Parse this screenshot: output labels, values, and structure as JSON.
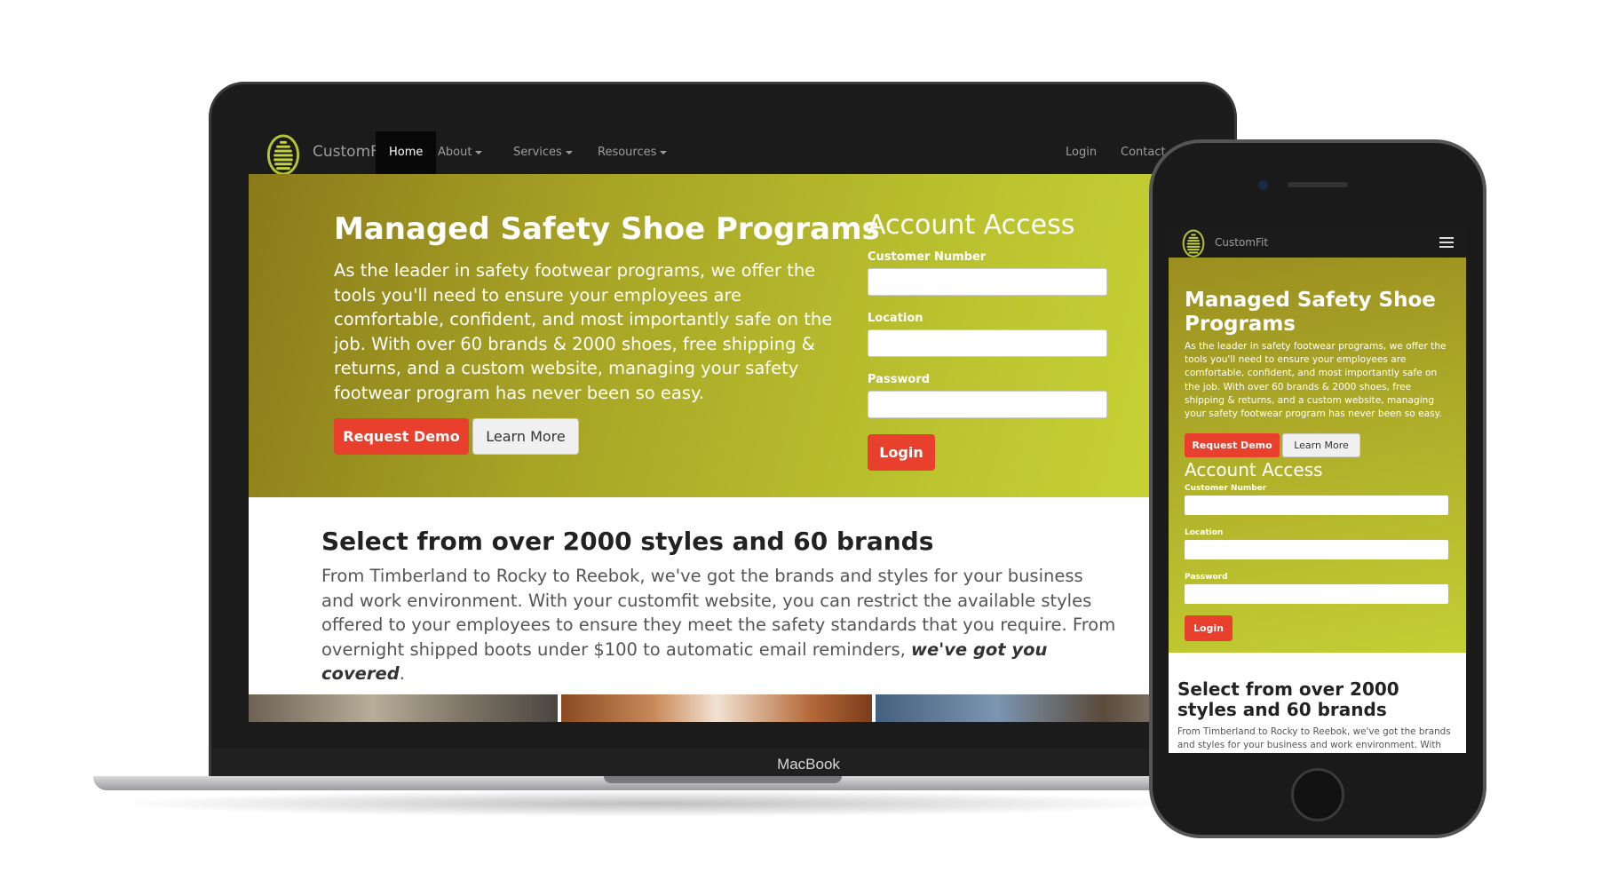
{
  "device_labels": {
    "laptop": "MacBook"
  },
  "site": {
    "brand": "CustomFit",
    "nav": {
      "items": [
        {
          "label": "Home",
          "dropdown": false,
          "active": true
        },
        {
          "label": "About",
          "dropdown": true
        },
        {
          "label": "Services",
          "dropdown": true
        },
        {
          "label": "Resources",
          "dropdown": true
        }
      ],
      "right": [
        {
          "label": "Login"
        },
        {
          "label": "Contact"
        }
      ]
    },
    "hero": {
      "title": "Managed Safety Shoe Programs",
      "body": "As the leader in safety footwear programs, we offer the tools you'll need to ensure your employees are comfortable, confident, and most importantly safe on the job. With over 60 brands & 2000 shoes, free shipping & returns, and a custom website, managing your safety footwear program has never been so easy.",
      "primary_button": "Request Demo",
      "secondary_button": "Learn More"
    },
    "account": {
      "title": "Account Access",
      "fields": [
        "Customer Number",
        "Location",
        "Password"
      ],
      "submit": "Login"
    },
    "section": {
      "title": "Select from over 2000 styles and 60 brands",
      "body": "From Timberland to Rocky to Reebok, we've got the brands and styles for your business and work environment. With your customfit website, you can restrict the available styles offered to your employees to ensure they meet the safety standards that you require. From overnight shipped boots under $100 to automatic email reminders, ",
      "emphasis": "we've got you covered",
      "end": "."
    },
    "mobile_section_body": "From Timberland to Rocky to Reebok, we've got the brands and styles for your business and work environment. With your"
  },
  "colors": {
    "accent_button": "#e8402c",
    "hero_green": "#b9c02e",
    "navbar": "#1b1b1b"
  },
  "icons": {
    "logo": "shoe-sole-logo-icon",
    "menu": "hamburger-menu-icon"
  }
}
